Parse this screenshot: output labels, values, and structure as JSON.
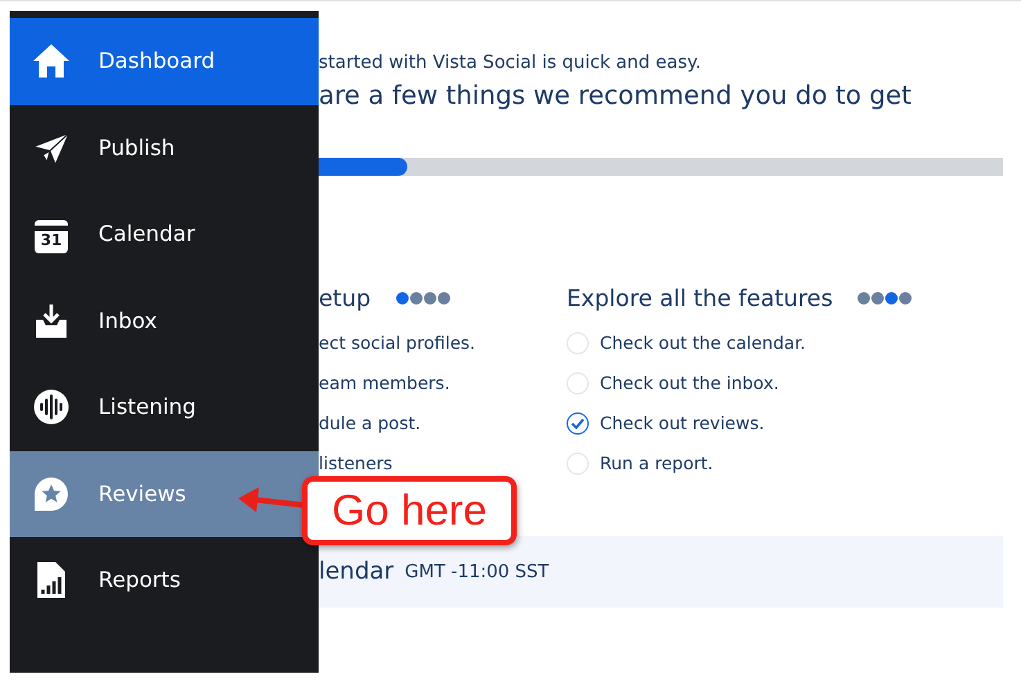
{
  "sidebar": {
    "items": [
      {
        "kind": "home",
        "label": "Dashboard",
        "selected": true,
        "hovered": false
      },
      {
        "kind": "plane",
        "label": "Publish",
        "selected": false,
        "hovered": false
      },
      {
        "kind": "calendar",
        "label": "Calendar",
        "icon_text": "31",
        "selected": false,
        "hovered": false
      },
      {
        "kind": "inbox",
        "label": "Inbox",
        "selected": false,
        "hovered": false
      },
      {
        "kind": "listening",
        "label": "Listening",
        "selected": false,
        "hovered": false
      },
      {
        "kind": "reviews",
        "label": "Reviews",
        "selected": false,
        "hovered": true
      },
      {
        "kind": "reports",
        "label": "Reports",
        "selected": false,
        "hovered": false
      }
    ]
  },
  "intro": "started with Vista Social is quick and easy.",
  "heading": "are a few things we recommend you do to get",
  "progress": {
    "level": 0.13
  },
  "sections": [
    {
      "title": "etup",
      "steps": [
        {
          "selected": true
        },
        {
          "selected": false
        },
        {
          "selected": false
        },
        {
          "selected": false
        }
      ],
      "tasks": [
        {
          "kind": "plain",
          "label": "ect social profiles."
        },
        {
          "kind": "plain",
          "label": "eam members."
        },
        {
          "kind": "plain",
          "label": "dule a post."
        },
        {
          "kind": "plain",
          "label": "listeners"
        }
      ]
    },
    {
      "title": "Explore all the features",
      "steps": [
        {
          "selected": false
        },
        {
          "selected": false
        },
        {
          "selected": true
        },
        {
          "selected": false
        }
      ],
      "tasks": [
        {
          "kind": "check",
          "label": "Check out the calendar.",
          "checked": false
        },
        {
          "kind": "check",
          "label": "Check out the inbox.",
          "checked": false
        },
        {
          "kind": "check",
          "label": "Check out reviews.",
          "checked": true
        },
        {
          "kind": "check",
          "label": "Run a report.",
          "checked": false
        }
      ]
    }
  ],
  "calendar_bar": {
    "title": "lendar",
    "timezone": "GMT -11:00 SST"
  },
  "callout": {
    "text": "Go here"
  }
}
